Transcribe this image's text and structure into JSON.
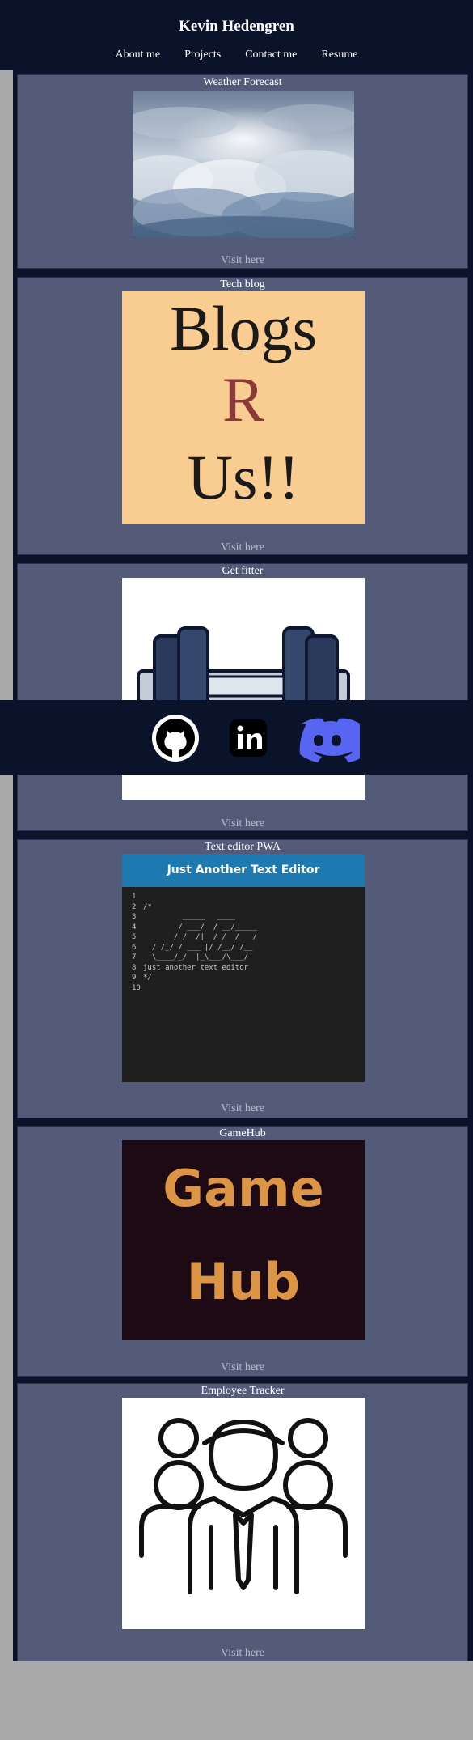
{
  "header": {
    "title": "Kevin Hedengren",
    "nav": [
      "About me",
      "Projects",
      "Contact me",
      "Resume"
    ]
  },
  "projects": [
    {
      "title": "Weather Forecast",
      "link": "Visit here"
    },
    {
      "title": "Tech blog",
      "link": "Visit here",
      "image_text": [
        "Blogs",
        "R",
        "Us!!"
      ]
    },
    {
      "title": "Get fitter",
      "link": "Visit here"
    },
    {
      "title": "Text editor PWA",
      "link": "Visit here",
      "image_header": "Just Another Text Editor",
      "editor_lines": [
        "1",
        "2",
        "3",
        "4",
        "5",
        "6",
        "7",
        "8",
        "9",
        "10"
      ],
      "editor_code": [
        "",
        "/*",
        "         _____   ____",
        "        / ___/  / __/_____",
        "   __  / /  /|  / /__/ __/",
        "  / /_/ / ___ |/ /__/ /__",
        "  \\____/_/  |_\\___/\\___/",
        "just another text editor",
        "*/",
        ""
      ]
    },
    {
      "title": "GameHub",
      "link": "Visit here",
      "image_text": [
        "Game",
        "Hub"
      ]
    },
    {
      "title": "Employee Tracker",
      "link": "Visit here"
    }
  ],
  "footer": {
    "icons": [
      "github-icon",
      "linkedin-icon",
      "discord-icon"
    ]
  },
  "colors": {
    "navy": "#0b132b",
    "card": "#535b78",
    "blog_bg": "#f9cd91",
    "blog_r": "#8b3a3a",
    "gamehub_bg": "#1e0a15",
    "gamehub_text": "#dc9445",
    "discord": "#5865f2",
    "editor_header": "#1e79b0"
  }
}
